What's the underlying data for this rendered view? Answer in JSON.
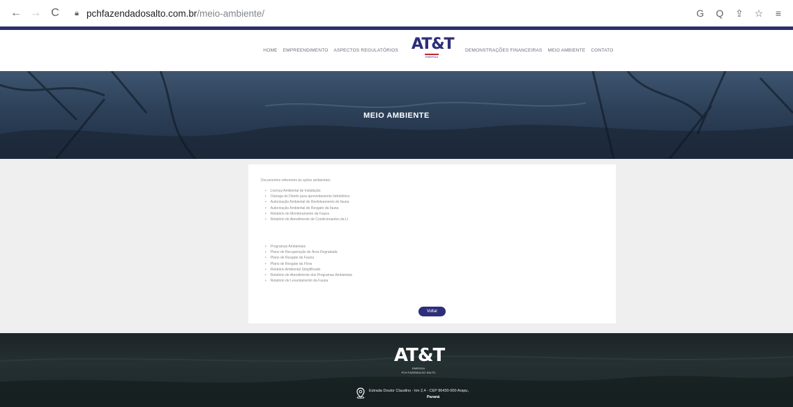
{
  "browser": {
    "back_icon": "←",
    "forward_icon": "→",
    "reload_icon": "C",
    "url_domain": "pchfazendadosalto.com.br",
    "url_path": "/meio-ambiente/",
    "actions": [
      "G",
      "Q",
      "⇪",
      "☆",
      "≡"
    ]
  },
  "header": {
    "menu_left": [
      "Home",
      "Empreendimento",
      "Aspectos regulatórios"
    ],
    "menu_right": [
      "Demonstrações financeiras",
      "Meio ambiente",
      "Contato"
    ],
    "logo_text": "AT&T",
    "logo_subtext": "ENERGIA"
  },
  "hero": {
    "title": "MEIO AMBIENTE"
  },
  "content": {
    "intro": "Documentos referentes às ações ambientais:",
    "group1": [
      "Licença Ambiental de Instalação",
      "Outorga do Direito para aproveitamento hidrelétrico",
      "Autorização Ambiental de Resfoleamento do fauna",
      "Autorização Ambiental de Resgate da fauna",
      "Relatório de Monitoramento da Fauna",
      "Relatório de Atendimento de Condicionantes da LI"
    ],
    "group2": [
      "Programas Ambientais",
      "Plano de Recuperação de Área Degradada",
      "Plano de Resgate da Fauna",
      "Plano de Resgate da Flora",
      "Relatório Ambiental Simplificado",
      "Relatório de Atendimento dos Programas Ambientais",
      "Relatório de Levantamento da Fauna"
    ],
    "back_label": "Voltar"
  },
  "footer": {
    "logo_text": "AT&T",
    "logo_line1": "ENERGIA",
    "logo_line2": "PCH FAZENDA DO SALTO",
    "address": "Estrada Doutor Claudino - km 2,4 - CEP 86430-000 Arapu,",
    "city": "Paraná"
  }
}
